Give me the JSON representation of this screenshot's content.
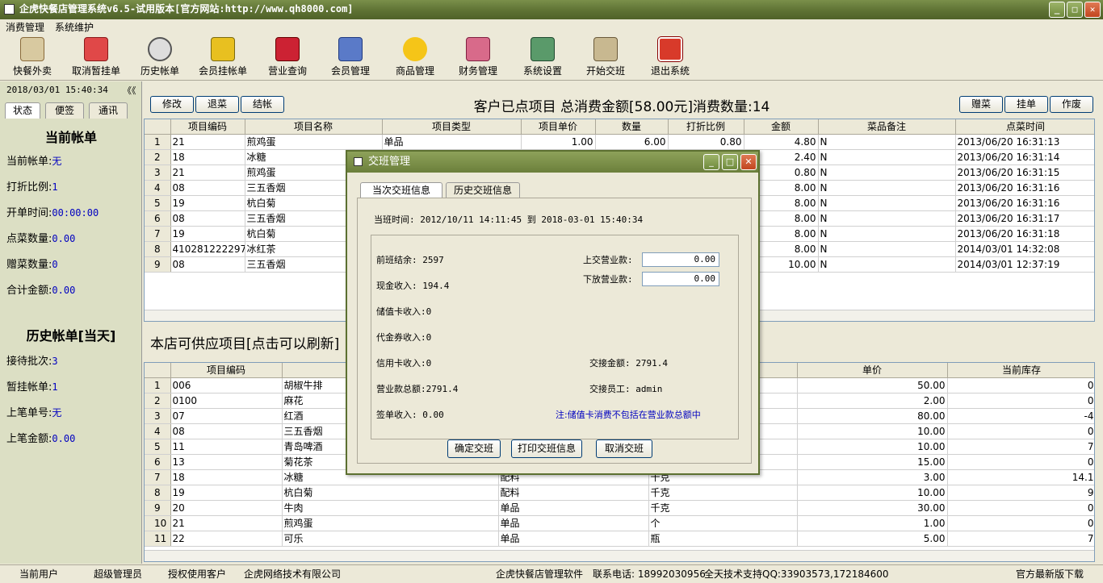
{
  "window": {
    "title": "企虎快餐店管理系统v6.5-试用版本[官方网站:http://www.qh8000.com]"
  },
  "menu": [
    "消费管理",
    "系统维护"
  ],
  "toolbar": [
    "快餐外卖",
    "取消暂挂单",
    "历史帐单",
    "会员挂帐单",
    "营业查询",
    "会员管理",
    "商品管理",
    "财务管理",
    "系统设置",
    "开始交班",
    "退出系统"
  ],
  "left": {
    "datetime": "2018/03/01 15:40:34",
    "collapse": "《《",
    "tabs": [
      "状态",
      "便签",
      "通讯"
    ],
    "current_title": "当前帐单",
    "current": [
      {
        "k": "当前帐单:",
        "v": "无"
      },
      {
        "k": "打折比例:",
        "v": "1"
      },
      {
        "k": "开单时间:",
        "v": "00:00:00"
      },
      {
        "k": "点菜数量:",
        "v": "0.00"
      },
      {
        "k": "赠菜数量:",
        "v": "0"
      },
      {
        "k": "合计金额:",
        "v": "0.00"
      }
    ],
    "history_title": "历史帐单[当天]",
    "history": [
      {
        "k": "接待批次:",
        "v": "3"
      },
      {
        "k": "暂挂帐单:",
        "v": "1"
      },
      {
        "k": "上笔单号:",
        "v": "无"
      },
      {
        "k": "上笔金额:",
        "v": "0.00"
      }
    ]
  },
  "order": {
    "buttons_left": [
      "修改",
      "退菜",
      "结帐"
    ],
    "buttons_right": [
      "赠菜",
      "挂单",
      "作废"
    ],
    "summary": "客户已点项目 总消费金额[58.00元]消费数量:14",
    "columns": [
      "项目编码",
      "项目名称",
      "项目类型",
      "项目单价",
      "数量",
      "打折比例",
      "金额",
      "菜品备注",
      "点菜时间"
    ],
    "rows": [
      [
        "1",
        "21",
        "煎鸡蛋",
        "单品",
        "1.00",
        "6.00",
        "0.80",
        "4.80",
        "N",
        "2013/06/20 16:31:13"
      ],
      [
        "2",
        "18",
        "冰糖",
        "",
        "",
        "",
        "",
        "2.40",
        "N",
        "2013/06/20 16:31:14"
      ],
      [
        "3",
        "21",
        "煎鸡蛋",
        "",
        "",
        "",
        "",
        "0.80",
        "N",
        "2013/06/20 16:31:15"
      ],
      [
        "4",
        "08",
        "三五香烟",
        "",
        "",
        "",
        "",
        "8.00",
        "N",
        "2013/06/20 16:31:16"
      ],
      [
        "5",
        "19",
        "杭白菊",
        "",
        "",
        "",
        "",
        "8.00",
        "N",
        "2013/06/20 16:31:16"
      ],
      [
        "6",
        "08",
        "三五香烟",
        "",
        "",
        "",
        "",
        "8.00",
        "N",
        "2013/06/20 16:31:17"
      ],
      [
        "7",
        "19",
        "杭白菊",
        "",
        "",
        "",
        "",
        "8.00",
        "N",
        "2013/06/20 16:31:18"
      ],
      [
        "8",
        "4102812222975",
        "冰红茶",
        "",
        "",
        "",
        "",
        "8.00",
        "N",
        "2014/03/01 14:32:08"
      ],
      [
        "9",
        "08",
        "三五香烟",
        "",
        "",
        "",
        "",
        "10.00",
        "N",
        "2014/03/01 12:37:19"
      ]
    ]
  },
  "supply": {
    "title": "本店可供应项目[点击可以刷新]",
    "columns": [
      "项目编码",
      "",
      "",
      "",
      "单价",
      "当前库存"
    ],
    "rows": [
      [
        "1",
        "006",
        "胡椒牛排",
        "",
        "",
        "50.00",
        "0"
      ],
      [
        "2",
        "0100",
        "麻花",
        "",
        "",
        "2.00",
        "0"
      ],
      [
        "3",
        "07",
        "红酒",
        "",
        "",
        "80.00",
        "-4"
      ],
      [
        "4",
        "08",
        "三五香烟",
        "",
        "",
        "10.00",
        "0"
      ],
      [
        "5",
        "11",
        "青岛啤酒",
        "",
        "",
        "10.00",
        "7"
      ],
      [
        "6",
        "13",
        "菊花茶",
        "",
        "",
        "15.00",
        "0"
      ],
      [
        "7",
        "18",
        "冰糖",
        "配料",
        "千克",
        "3.00",
        "14.1"
      ],
      [
        "8",
        "19",
        "杭白菊",
        "配料",
        "千克",
        "10.00",
        "9"
      ],
      [
        "9",
        "20",
        "牛肉",
        "单品",
        "千克",
        "30.00",
        "0"
      ],
      [
        "10",
        "21",
        "煎鸡蛋",
        "单品",
        "个",
        "1.00",
        "0"
      ],
      [
        "11",
        "22",
        "可乐",
        "单品",
        "瓶",
        "5.00",
        "7"
      ]
    ]
  },
  "dialog": {
    "title": "交班管理",
    "tabs": [
      "当次交班信息",
      "历史交班信息"
    ],
    "shift_time": "当班时间: 2012/10/11 14:11:45 到 2018-03-01 15:40:34",
    "left_fields": [
      "前班结余: 2597",
      "现金收入: 194.4",
      "储值卡收入:0",
      "代金券收入:0",
      "信用卡收入:0",
      "营业款总额:2791.4",
      "签单收入: 0.00"
    ],
    "upload_label": "上交营业款:",
    "upload_value": "0.00",
    "release_label": "下放营业款:",
    "release_value": "0.00",
    "handover_amount": "交接金额: 2791.4",
    "handover_staff": "交接员工: admin",
    "note": "注:储值卡消费不包括在营业款总额中",
    "buttons": [
      "确定交班",
      "打印交班信息",
      "取消交班"
    ]
  },
  "status": {
    "current_user_label": "当前用户",
    "current_user": "超级管理员",
    "license_label": "授权使用客户",
    "license": "企虎网络技术有限公司",
    "software": "企虎快餐店管理软件",
    "phone": "联系电话: 18992030956",
    "support": "全天技术支持QQ:33903573,172184600",
    "download": "官方最新版下载"
  }
}
